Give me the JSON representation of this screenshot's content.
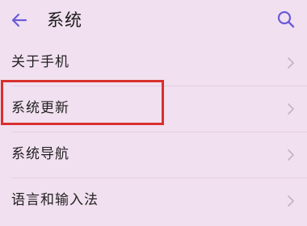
{
  "header": {
    "title": "系统",
    "back_icon": "arrow-left-icon",
    "search_icon": "search-icon"
  },
  "items": [
    {
      "label": "关于手机"
    },
    {
      "label": "系统更新"
    },
    {
      "label": "系统导航"
    },
    {
      "label": "语言和输入法"
    }
  ],
  "colors": {
    "background": "#f1e0f0",
    "accent": "#6b5bd6",
    "highlight": "#d8302d"
  }
}
